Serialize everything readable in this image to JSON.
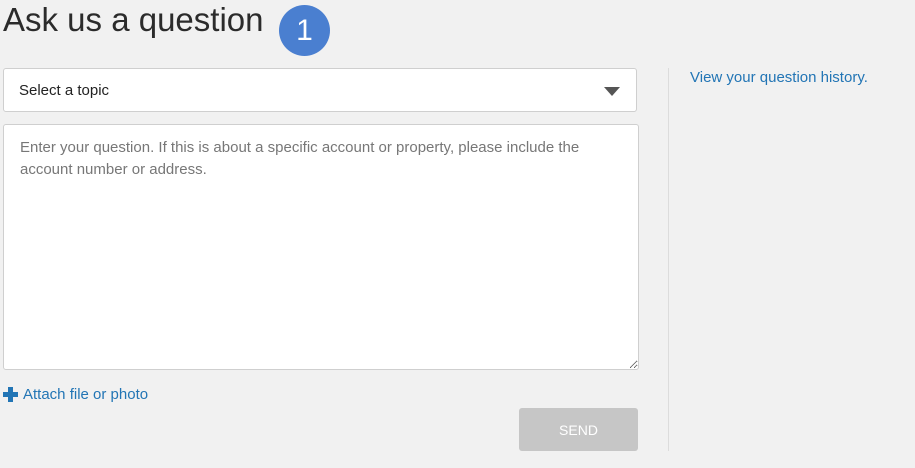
{
  "page": {
    "title": "Ask us a question",
    "step_number": "1"
  },
  "form": {
    "topic_select": {
      "selected": "Select a topic"
    },
    "question": {
      "value": "",
      "placeholder": "Enter your question. If this is about a specific account or property, please include the account number or address."
    },
    "attach_label": "Attach file or photo",
    "send_label": "SEND"
  },
  "sidebar": {
    "history_link": "View your question history."
  },
  "colors": {
    "background": "#f1f1f1",
    "link": "#2275b5",
    "badge": "#4a7fd0",
    "send_disabled": "#c6c6c6"
  },
  "icons": {
    "dropdown": "chevron-down-icon",
    "attach": "plus-icon"
  }
}
